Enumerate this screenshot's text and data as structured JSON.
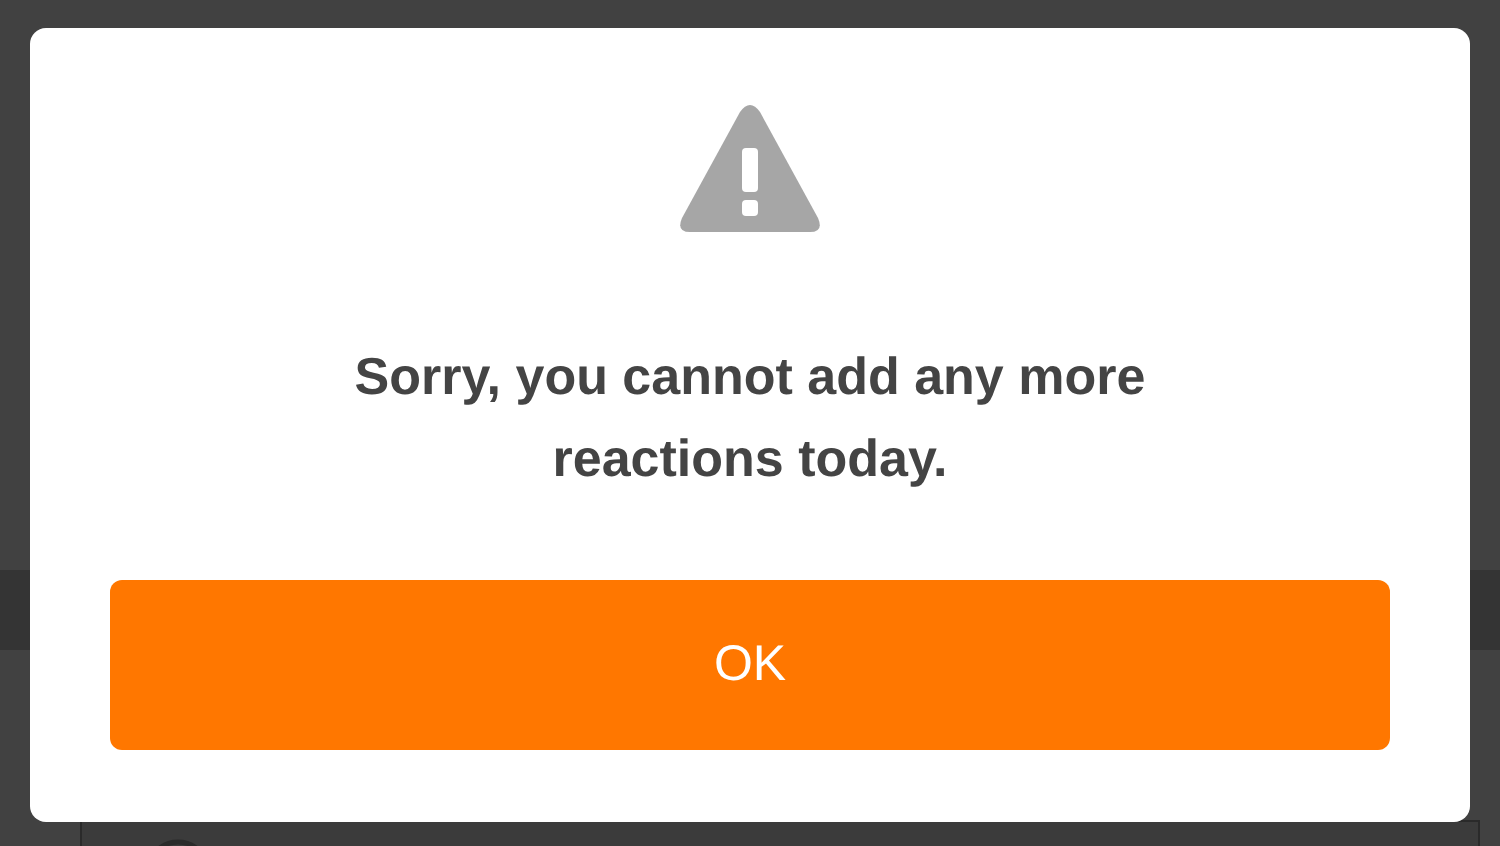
{
  "dialog": {
    "message": "Sorry, you cannot add any more reactions today.",
    "buttons": [
      "OK"
    ]
  }
}
